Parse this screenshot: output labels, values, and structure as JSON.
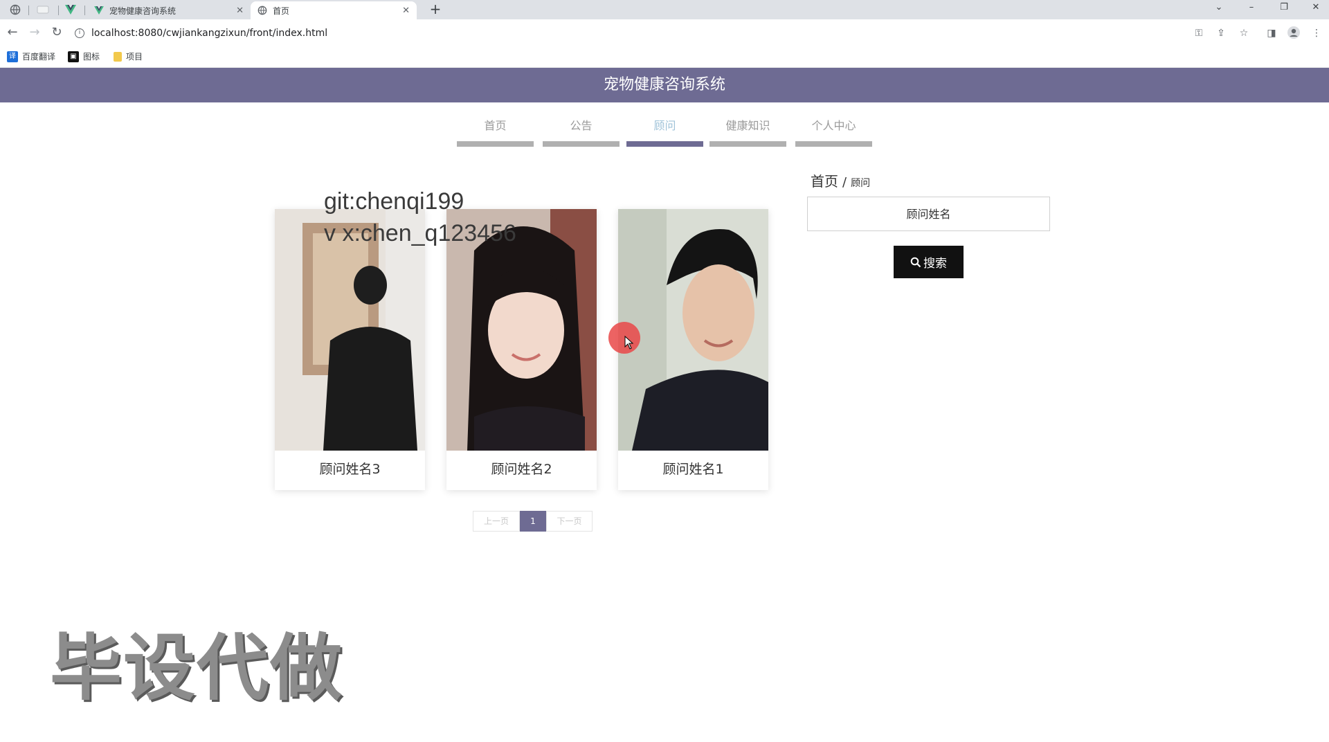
{
  "browser": {
    "tabs": [
      {
        "title": "宠物健康咨询系统",
        "active": false
      },
      {
        "title": "首页",
        "active": true
      }
    ],
    "new_tab": "+",
    "url": "localhost:8080/cwjiankangzixun/front/index.html",
    "bookmarks": [
      {
        "label": "百度翻译",
        "icon": "translate-icon",
        "color": "#1e6fd9"
      },
      {
        "label": "图标",
        "icon": "image-icon",
        "color": "#111111"
      },
      {
        "label": "项目",
        "icon": "folder-icon",
        "color": "#f2c94c"
      }
    ]
  },
  "site": {
    "title": "宠物健康咨询系统",
    "header_color": "#6e6b93"
  },
  "nav": {
    "items": [
      {
        "label": "首页",
        "active": false
      },
      {
        "label": "公告",
        "active": false
      },
      {
        "label": "顾问",
        "active": true
      },
      {
        "label": "健康知识",
        "active": false
      },
      {
        "label": "个人中心",
        "active": false
      }
    ]
  },
  "consultants": [
    {
      "name": "顾问姓名3"
    },
    {
      "name": "顾问姓名2"
    },
    {
      "name": "顾问姓名1"
    }
  ],
  "pagination": {
    "prev": "上一页",
    "current": "1",
    "next": "下一页"
  },
  "breadcrumb": {
    "home": "首页",
    "separator": "/",
    "current": "顾问"
  },
  "search": {
    "placeholder": "顾问姓名",
    "button_label": "搜索"
  },
  "overlay": {
    "line1": "git:chenqi199",
    "line2": "v x:chen_q123456",
    "watermark": "毕设代做"
  }
}
